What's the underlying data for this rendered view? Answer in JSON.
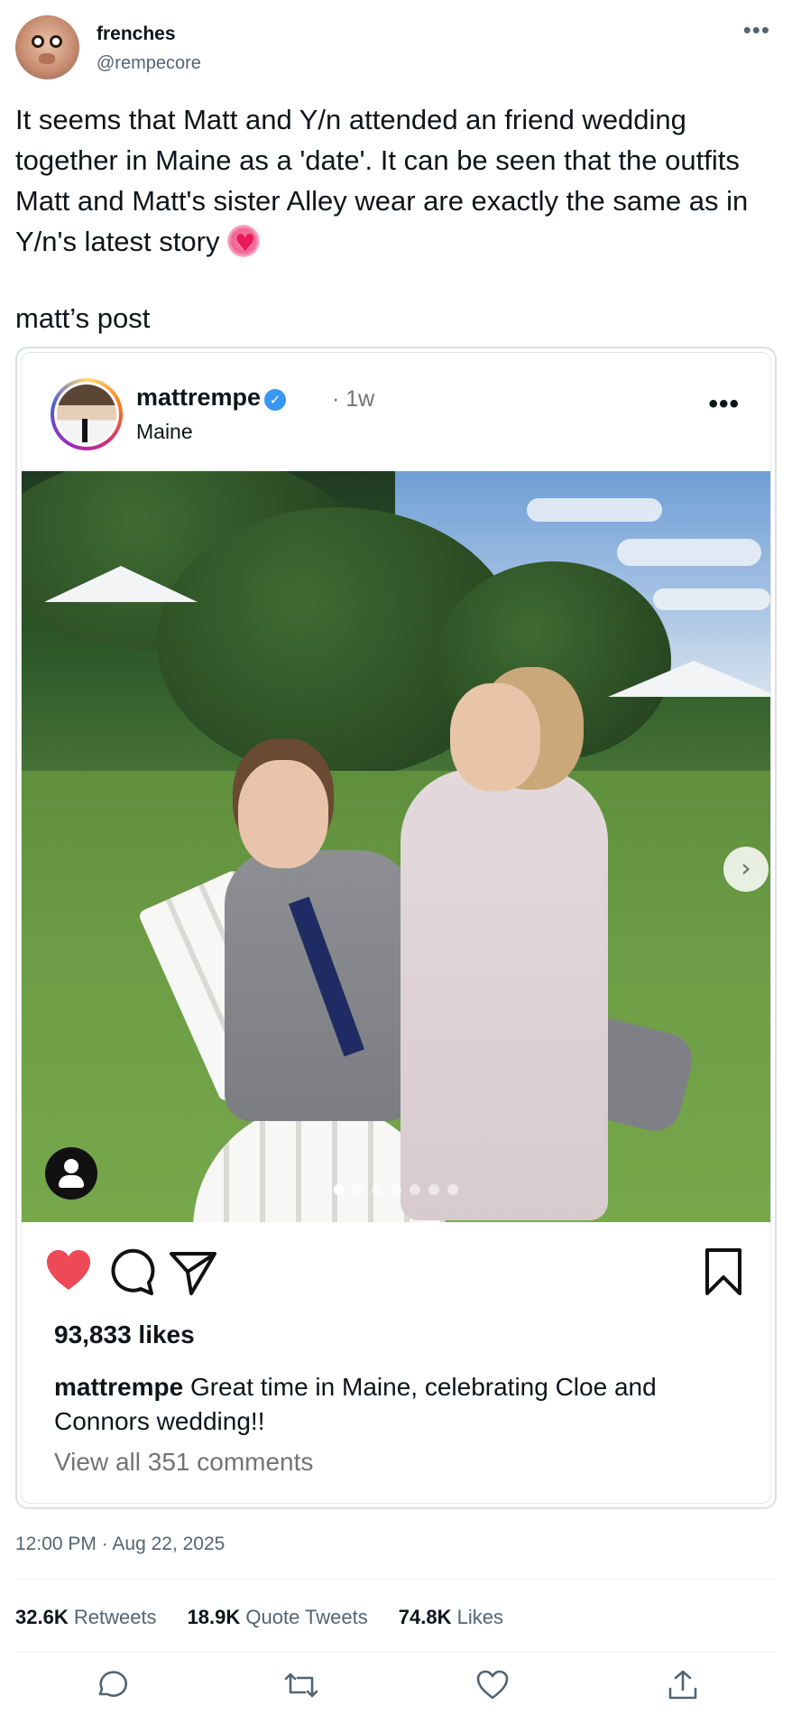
{
  "tweet": {
    "display_name": "frenches",
    "handle": "@rempecore",
    "more_icon": "more-horizontal-icon",
    "text": "It seems that Matt and Y/n attended an friend wedding together in Maine as a 'date'. It can be seen that the outfits Matt and Matt's sister Alley wear are exactly the same as in Y/n's latest story ",
    "subline": "matt’s post",
    "timestamp": "12:00 PM · Aug 22, 2025"
  },
  "instagram_post": {
    "username": "mattrempe",
    "verified_icon": "verified-badge-icon",
    "time_ago": "· 1w",
    "location": "Maine",
    "more_icon": "more-horizontal-icon",
    "carousel": {
      "next_icon": "chevron-right-icon",
      "current_slide": 1,
      "total_slides": 7
    },
    "user_tag_icon": "person-icon",
    "likes": "93,833 likes",
    "caption_user": "mattrempe",
    "caption_text": " Great time in Maine, celebrating Cloe and Connors wedding!!",
    "view_comments": "View all 351 comments",
    "colors": {
      "like": "#ed4956"
    }
  },
  "stats": [
    {
      "value": "32.6K",
      "label": "Retweets"
    },
    {
      "value": "18.9K",
      "label": "Quote Tweets"
    },
    {
      "value": "74.8K",
      "label": "Likes"
    }
  ],
  "action_bar": [
    "reply-icon",
    "retweet-icon",
    "like-icon",
    "share-icon"
  ]
}
